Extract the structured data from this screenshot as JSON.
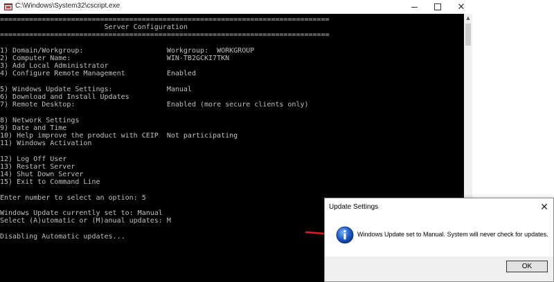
{
  "window": {
    "title": "C:\\Windows\\System32\\cscript.exe",
    "minimize_glyph": "",
    "maximize_glyph": "",
    "close_glyph": "✕"
  },
  "console": {
    "lines": [
      "===============================================================================",
      "                         Server Configuration",
      "===============================================================================",
      "",
      "1) Domain/Workgroup:                    Workgroup:  WORKGROUP",
      "2) Computer Name:                       WIN-TB2GCKI7TKN",
      "3) Add Local Administrator",
      "4) Configure Remote Management          Enabled",
      "",
      "5) Windows Update Settings:             Manual",
      "6) Download and Install Updates",
      "7) Remote Desktop:                      Enabled (more secure clients only)",
      "",
      "8) Network Settings",
      "9) Date and Time",
      "10) Help improve the product with CEIP  Not participating",
      "11) Windows Activation",
      "",
      "12) Log Off User",
      "13) Restart Server",
      "14) Shut Down Server",
      "15) Exit to Command Line",
      "",
      "Enter number to select an option: 5",
      "",
      "Windows Update currently set to: Manual",
      "Select (A)utomatic or (M)anual updates: M",
      "",
      "Disabling Automatic updates..."
    ]
  },
  "dialog": {
    "title": "Update Settings",
    "close_glyph": "✕",
    "message": "Windows Update set to Manual.  System will never check for updates.",
    "ok_label": "OK",
    "icon": "info-icon"
  },
  "scrollbar": {
    "up_glyph": "▲"
  },
  "colors": {
    "console_bg": "#000000",
    "console_text": "#c0c0c0",
    "arrow": "#e02020",
    "info_icon": "#1f5fc8"
  }
}
